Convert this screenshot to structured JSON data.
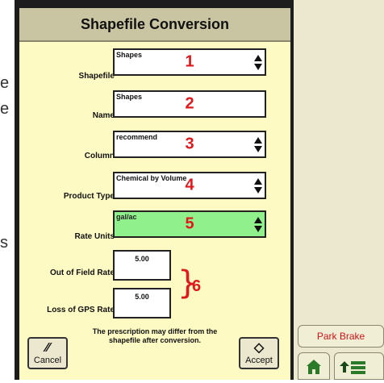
{
  "stray_text": [
    "e",
    "e",
    "s"
  ],
  "dialog": {
    "title": "Shapefile Conversion",
    "fields": [
      {
        "label": "Shapefile",
        "value": "Shapes",
        "marker": "1"
      },
      {
        "label": "Name",
        "value": "Shapes",
        "marker": "2"
      },
      {
        "label": "Column",
        "value": "recommend",
        "marker": "3"
      },
      {
        "label": "Product Type",
        "value": "Chemical by Volume",
        "marker": "4"
      },
      {
        "label": "Rate Units",
        "value": "gal/ac",
        "marker": "5"
      }
    ],
    "rates": [
      {
        "label": "Out of Field Rate",
        "value": "5.00"
      },
      {
        "label": "Loss of GPS Rate",
        "value": "5.00"
      }
    ],
    "rates_marker": "6",
    "note": "The prescription may differ from the shapefile after conversion.",
    "cancel_label": "Cancel",
    "accept_label": "Accept"
  },
  "side": {
    "park_brake_label": "Park Brake"
  },
  "colors": {
    "dialog_bg": "#fdfbc3",
    "title_bg": "#c9c4a2",
    "highlight_field": "#8ff08c",
    "marker": "#e0191c",
    "park_brake_text": "#d0141a"
  },
  "icons": {
    "cancel": "percent-slash-icon",
    "accept": "check-diamond-icon",
    "home": "home-icon",
    "menu": "menu-up-icon"
  }
}
